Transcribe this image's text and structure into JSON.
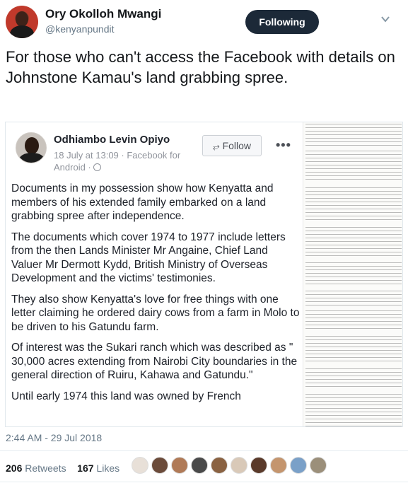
{
  "tweet": {
    "display_name": "Ory Okolloh Mwangi",
    "handle": "@kenyanpundit",
    "follow_label": "Following",
    "text": "For those who can't access the Facebook with details on Johnstone Kamau's land grabbing spree.",
    "timestamp": "2:44 AM - 29 Jul 2018",
    "retweets_count": "206",
    "retweets_label": "Retweets",
    "likes_count": "167",
    "likes_label": "Likes"
  },
  "embedded_post": {
    "author": "Odhiambo Levin Opiyo",
    "meta_line1": "18 July at 13:09 · Facebook for",
    "meta_line2": "Android ·",
    "follow_label": "Follow",
    "paragraphs": [
      "Documents in my possession show how Kenyatta and members of his extended family embarked on a land grabbing spree after independence.",
      "The documents which cover 1974 to 1977 include letters from the then Lands Minister Mr Angaine, Chief Land Valuer Mr Dermott Kydd, British Ministry of Overseas Development and the victims' testimonies.",
      "They also show Kenyatta's love for free things with one letter claiming he ordered dairy cows from a farm in Molo to be driven to his Gatundu farm.",
      "Of interest was the Sukari ranch which was described as \" 30,000 acres extending from Nairobi City boundaries in the general direction of Ruiru, Kahawa and Gatundu.\"",
      "Until early 1974 this land was owned by French"
    ]
  },
  "icons": {
    "caret": "chevron-down-icon",
    "follow": "rss-icon",
    "more": "more-options-icon",
    "privacy": "globe-icon"
  },
  "colors": {
    "following_button_bg": "#1c2938",
    "muted_text": "#657786",
    "fb_meta": "#90949c"
  }
}
